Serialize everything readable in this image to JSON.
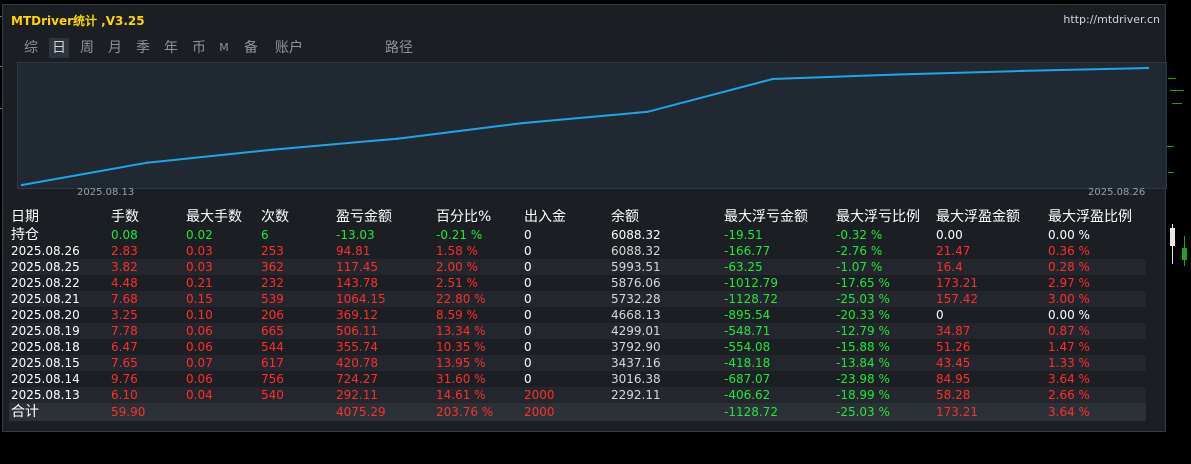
{
  "app": {
    "title": "MTDriver统计 ,V3.25",
    "url": "http://mtdriver.cn"
  },
  "tabs": [
    {
      "label": "综",
      "active": false,
      "small": false
    },
    {
      "label": "日",
      "active": true,
      "small": false
    },
    {
      "label": "周",
      "active": false,
      "small": false
    },
    {
      "label": "月",
      "active": false,
      "small": false
    },
    {
      "label": "季",
      "active": false,
      "small": false
    },
    {
      "label": "年",
      "active": false,
      "small": false
    },
    {
      "label": "币",
      "active": false,
      "small": false
    },
    {
      "label": "M",
      "active": false,
      "small": true
    },
    {
      "label": "备",
      "active": false,
      "small": false
    },
    {
      "label": "账户",
      "active": false,
      "small": false
    },
    {
      "label": "路径",
      "active": false,
      "small": false
    }
  ],
  "chart_data": {
    "type": "line",
    "x_start_label": "2025.08.13",
    "x_end_label": "2025.08.26",
    "x": [
      "2025.08.13",
      "2025.08.14",
      "2025.08.15",
      "2025.08.18",
      "2025.08.19",
      "2025.08.20",
      "2025.08.21",
      "2025.08.22",
      "2025.08.25",
      "2025.08.26"
    ],
    "series": [
      {
        "values": [
          2292.11,
          3016.38,
          3437.16,
          3792.9,
          4299.01,
          4668.13,
          5732.28,
          5876.06,
          5993.51,
          6088.32
        ]
      }
    ],
    "line_color": "#18a8e8"
  },
  "table": {
    "headers": [
      "日期",
      "手数",
      "最大手数",
      "次数",
      "盈亏金额",
      "百分比%",
      "出入金",
      "余额",
      "最大浮亏金额",
      "最大浮亏比例",
      "最大浮盈金额",
      "最大浮盈比例"
    ],
    "holding": {
      "label": "持仓",
      "cells": [
        "0.08",
        "0.02",
        "6",
        "-13.03",
        "-0.21 %",
        "0",
        "6088.32",
        "-19.51",
        "-0.32 %",
        "0.00",
        "0.00 %"
      ]
    },
    "rows": [
      {
        "date": "2025.08.26",
        "cells": [
          "2.83",
          "0.03",
          "253",
          "94.81",
          "1.58 %",
          "0",
          "6088.32",
          "-166.77",
          "-2.76 %",
          "21.47",
          "0.36 %"
        ]
      },
      {
        "date": "2025.08.25",
        "cells": [
          "3.82",
          "0.03",
          "362",
          "117.45",
          "2.00 %",
          "0",
          "5993.51",
          "-63.25",
          "-1.07 %",
          "16.4",
          "0.28 %"
        ]
      },
      {
        "date": "2025.08.22",
        "cells": [
          "4.48",
          "0.21",
          "232",
          "143.78",
          "2.51 %",
          "0",
          "5876.06",
          "-1012.79",
          "-17.65 %",
          "173.21",
          "2.97 %"
        ]
      },
      {
        "date": "2025.08.21",
        "cells": [
          "7.68",
          "0.15",
          "539",
          "1064.15",
          "22.80 %",
          "0",
          "5732.28",
          "-1128.72",
          "-25.03 %",
          "157.42",
          "3.00 %"
        ]
      },
      {
        "date": "2025.08.20",
        "cells": [
          "3.25",
          "0.10",
          "206",
          "369.12",
          "8.59 %",
          "0",
          "4668.13",
          "-895.54",
          "-20.33 %",
          "0",
          "0.00 %"
        ]
      },
      {
        "date": "2025.08.19",
        "cells": [
          "7.78",
          "0.06",
          "665",
          "506.11",
          "13.34 %",
          "0",
          "4299.01",
          "-548.71",
          "-12.79 %",
          "34.87",
          "0.87 %"
        ]
      },
      {
        "date": "2025.08.18",
        "cells": [
          "6.47",
          "0.06",
          "544",
          "355.74",
          "10.35 %",
          "0",
          "3792.90",
          "-554.08",
          "-15.88 %",
          "51.26",
          "1.47 %"
        ]
      },
      {
        "date": "2025.08.15",
        "cells": [
          "7.65",
          "0.07",
          "617",
          "420.78",
          "13.95 %",
          "0",
          "3437.16",
          "-418.18",
          "-13.84 %",
          "43.45",
          "1.33 %"
        ]
      },
      {
        "date": "2025.08.14",
        "cells": [
          "9.76",
          "0.06",
          "756",
          "724.27",
          "31.60 %",
          "0",
          "3016.38",
          "-687.07",
          "-23.98 %",
          "84.95",
          "3.64 %"
        ]
      },
      {
        "date": "2025.08.13",
        "cells": [
          "6.10",
          "0.04",
          "540",
          "292.11",
          "14.61 %",
          "2000",
          "2292.11",
          "-406.62",
          "-18.99 %",
          "58.28",
          "2.66 %"
        ]
      }
    ],
    "total": {
      "label": "合计",
      "cells": [
        "59.90",
        "",
        "",
        "4075.29",
        "203.76 %",
        "2000",
        "",
        "-1128.72",
        "-25.03 %",
        "173.21",
        "3.64 %"
      ]
    }
  }
}
